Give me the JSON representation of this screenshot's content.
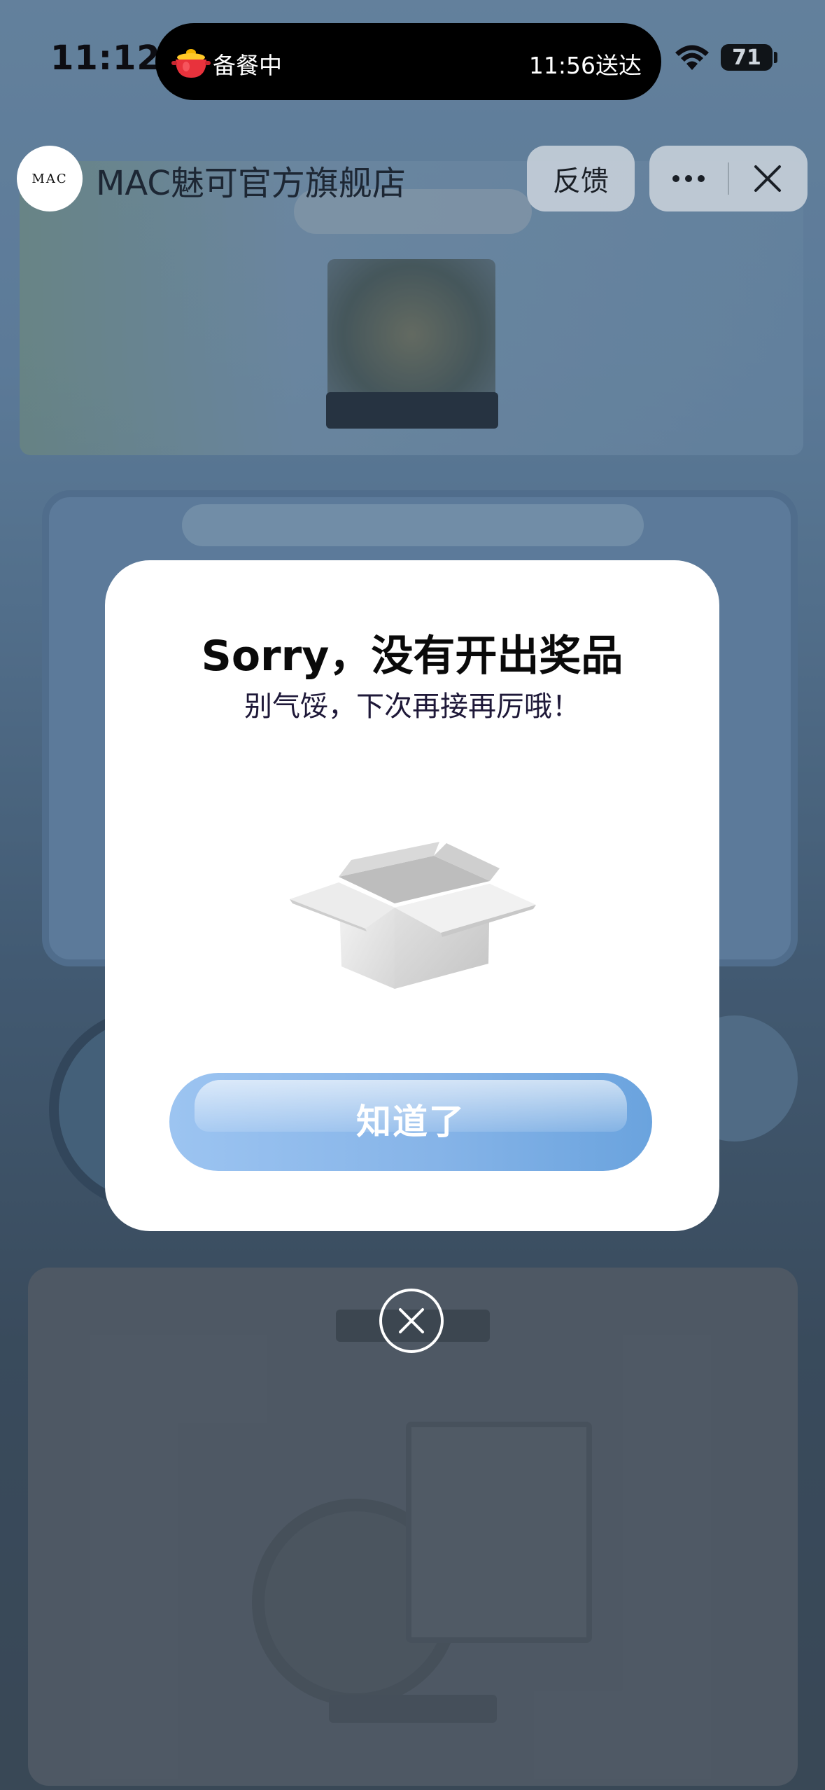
{
  "status_bar": {
    "time": "11:12",
    "battery_level": "71",
    "live_activity": {
      "status": "备餐中",
      "eta": "11:56送达",
      "icon": "cooking-pot-icon"
    }
  },
  "nav_bar": {
    "store_logo": "MAC",
    "store_name": "MAC魅可官方旗舰店",
    "feedback_label": "反馈",
    "more_icon": "more-dots-icon",
    "close_icon": "close-icon"
  },
  "modal": {
    "title": "Sorry，没有开出奖品",
    "subtitle": "别气馁，下次再接再厉哦！",
    "illustration": "empty-box-icon",
    "confirm_label": "知道了",
    "dismiss_icon": "circle-close-icon"
  },
  "colors": {
    "button_gradient_start": "#9cc4f1",
    "button_gradient_end": "#6aa3de",
    "modal_background": "#ffffff",
    "island_background": "#000000"
  }
}
